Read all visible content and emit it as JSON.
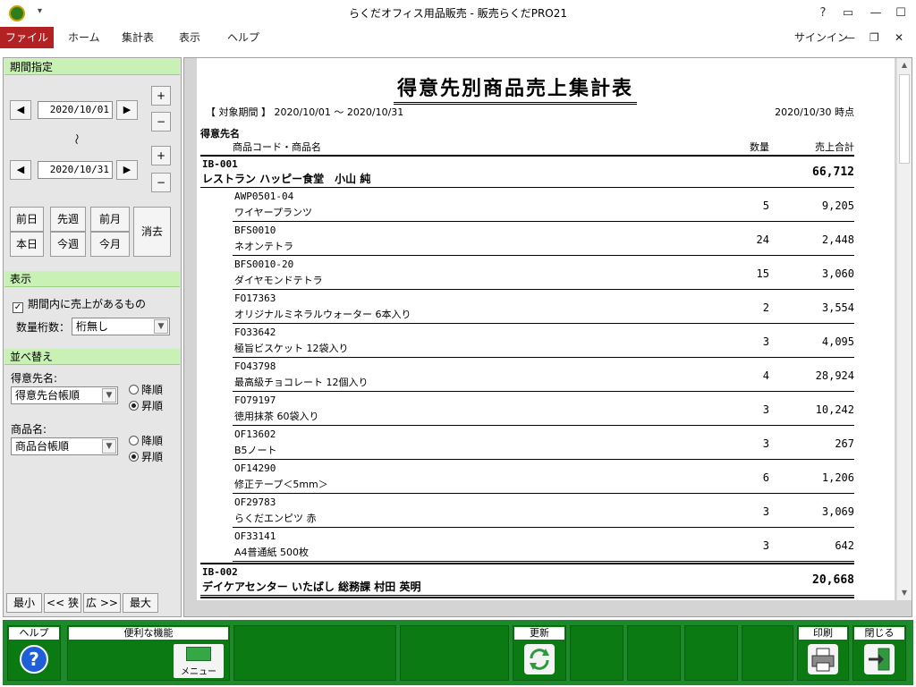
{
  "titlebar": {
    "title": "らくだオフィス用品販売 - 販売らくだPRO21",
    "help": "?",
    "ribbon_toggle": "▭",
    "minimize": "—",
    "maximize": "☐",
    "close": "✕"
  },
  "ribbon": {
    "tabs": [
      "ファイル",
      "ホーム",
      "集計表",
      "表示",
      "ヘルプ"
    ],
    "signin": "サインイン",
    "inner_minimize": "—",
    "inner_restore": "❐",
    "inner_close": "✕"
  },
  "left": {
    "period_head": "期間指定",
    "date_from": "2020/10/01",
    "date_to": "2020/10/31",
    "tilde": "〜",
    "plus": "+",
    "minus": "−",
    "prev": "◀",
    "next": "▶",
    "quick": [
      "前日",
      "先週",
      "前月",
      "本日",
      "今週",
      "今月"
    ],
    "clear": "消去",
    "display_head": "表示",
    "has_sales_checkbox": "期間内に売上があるもの",
    "qty_digits_label": "数量桁数：",
    "qty_digits_value": "桁無し",
    "sort_head": "並べ替え",
    "customer_label": "得意先名:",
    "customer_sort": "得意先台帳順",
    "product_label": "商品名:",
    "product_sort": "商品台帳順",
    "desc": "降順",
    "asc": "昇順",
    "zoom": [
      "最小",
      "<< 狭",
      "広 >>",
      "最大"
    ]
  },
  "report": {
    "title": "得意先別商品売上集計表",
    "period": "【 対象期間 】 2020/10/01 〜 2020/10/31",
    "asof": "2020/10/30 時点",
    "col_customer": "得意先名",
    "col_product": "商品コード・商品名",
    "col_qty": "数量",
    "col_total": "売上合計",
    "groups": [
      {
        "code": "IB-001",
        "name": "レストラン ハッピー食堂　小山 純",
        "total": "66,712",
        "items": [
          {
            "code": "AWP0501-04",
            "name": "ワイヤープランツ",
            "qty": "5",
            "amount": "9,205"
          },
          {
            "code": "BFS0010",
            "name": "ネオンテトラ",
            "qty": "24",
            "amount": "2,448"
          },
          {
            "code": "BFS0010-20",
            "name": "ダイヤモンドテトラ",
            "qty": "15",
            "amount": "3,060"
          },
          {
            "code": "FO17363",
            "name": "オリジナルミネラルウォーター 6本入り",
            "qty": "2",
            "amount": "3,554"
          },
          {
            "code": "FO33642",
            "name": "極旨ビスケット 12袋入り",
            "qty": "3",
            "amount": "4,095"
          },
          {
            "code": "FO43798",
            "name": "最高級チョコレート 12個入り",
            "qty": "4",
            "amount": "28,924"
          },
          {
            "code": "FO79197",
            "name": "徳用抹茶 60袋入り",
            "qty": "3",
            "amount": "10,242"
          },
          {
            "code": "OF13602",
            "name": "B5ノート",
            "qty": "3",
            "amount": "267"
          },
          {
            "code": "OF14290",
            "name": "修正テープ＜5mm＞",
            "qty": "6",
            "amount": "1,206"
          },
          {
            "code": "OF29783",
            "name": "らくだエンピツ 赤",
            "qty": "3",
            "amount": "3,069"
          },
          {
            "code": "OF33141",
            "name": "A4普通紙 500枚",
            "qty": "3",
            "amount": "642"
          }
        ]
      },
      {
        "code": "IB-002",
        "name": "デイケアセンター いたばし 総務課 村田 英明",
        "total": "20,668",
        "items": []
      }
    ]
  },
  "funcbar": {
    "help": "ヘルプ",
    "tools": "便利な機能",
    "menu": "メニュー",
    "refresh": "更新",
    "print": "印刷",
    "close": "閉じる"
  },
  "colors": {
    "accent_file_tab": "#b22222",
    "section_head": "#c9f0b5",
    "funcbar_bg": "#1c8a2a",
    "funcbar_key": "#0b7a12"
  }
}
